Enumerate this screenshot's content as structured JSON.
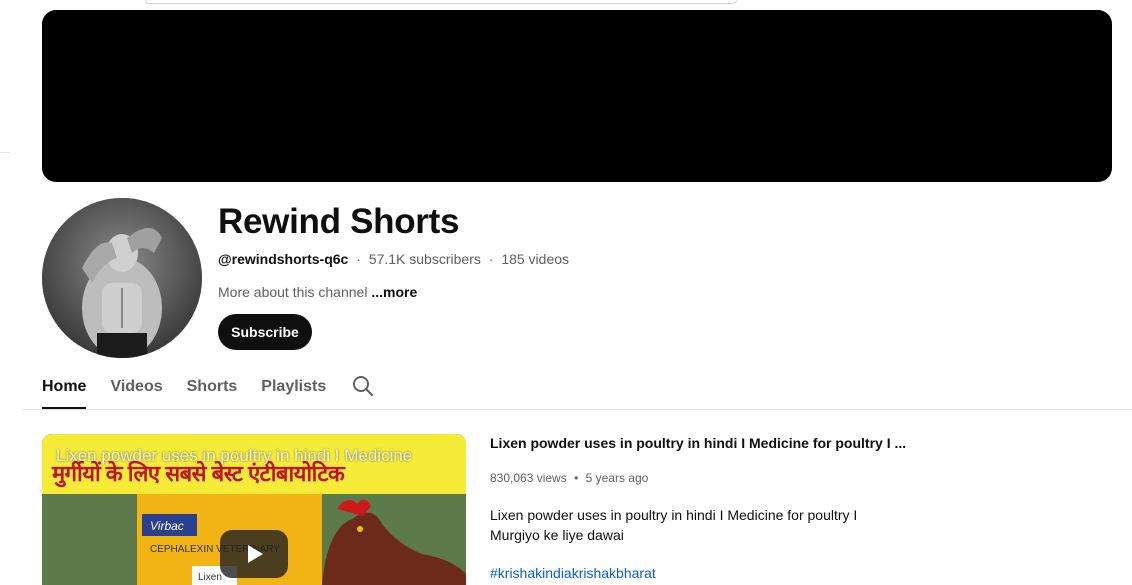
{
  "channel": {
    "name": "Rewind Shorts",
    "handle": "@rewindshorts-q6c",
    "subscribers": "57.1K subscribers",
    "videos": "185 videos",
    "separator": "·",
    "about_text": "More about this channel",
    "about_more": "...more",
    "subscribe_label": "Subscribe"
  },
  "tabs": [
    {
      "label": "Home",
      "active": true
    },
    {
      "label": "Videos",
      "active": false
    },
    {
      "label": "Shorts",
      "active": false
    },
    {
      "label": "Playlists",
      "active": false
    }
  ],
  "featured_video": {
    "thumbnail_overlay_title": "Lixen powder uses in poultry in hindi  I  Medicine",
    "thumbnail_hindi_text": "मुर्गीयों के लिए सबसे बेस्ट एंटीबायोटिक",
    "thumbnail_brand": "Virbac",
    "thumbnail_product_text": "CEPHALEXIN VETERINARY",
    "thumbnail_pack_label": "Lixen",
    "title": "Lixen powder uses in poultry in hindi  I  Medicine for poultry  I  ...",
    "views": "830,063 views",
    "dot": "•",
    "age": "5 years ago",
    "description_line1": "Lixen powder uses in poultry in hindi  I  Medicine for poultry  I",
    "description_line2": "Murgiyo ke liye dawai",
    "hashtag": "#krishakindiakrishakbharat"
  },
  "icons": {
    "search": "search-icon",
    "play": "play-icon"
  },
  "colors": {
    "banner": "#000000",
    "subscribe_bg": "#0f0f0f",
    "link": "#065fd4",
    "secondary_text": "#606060"
  }
}
